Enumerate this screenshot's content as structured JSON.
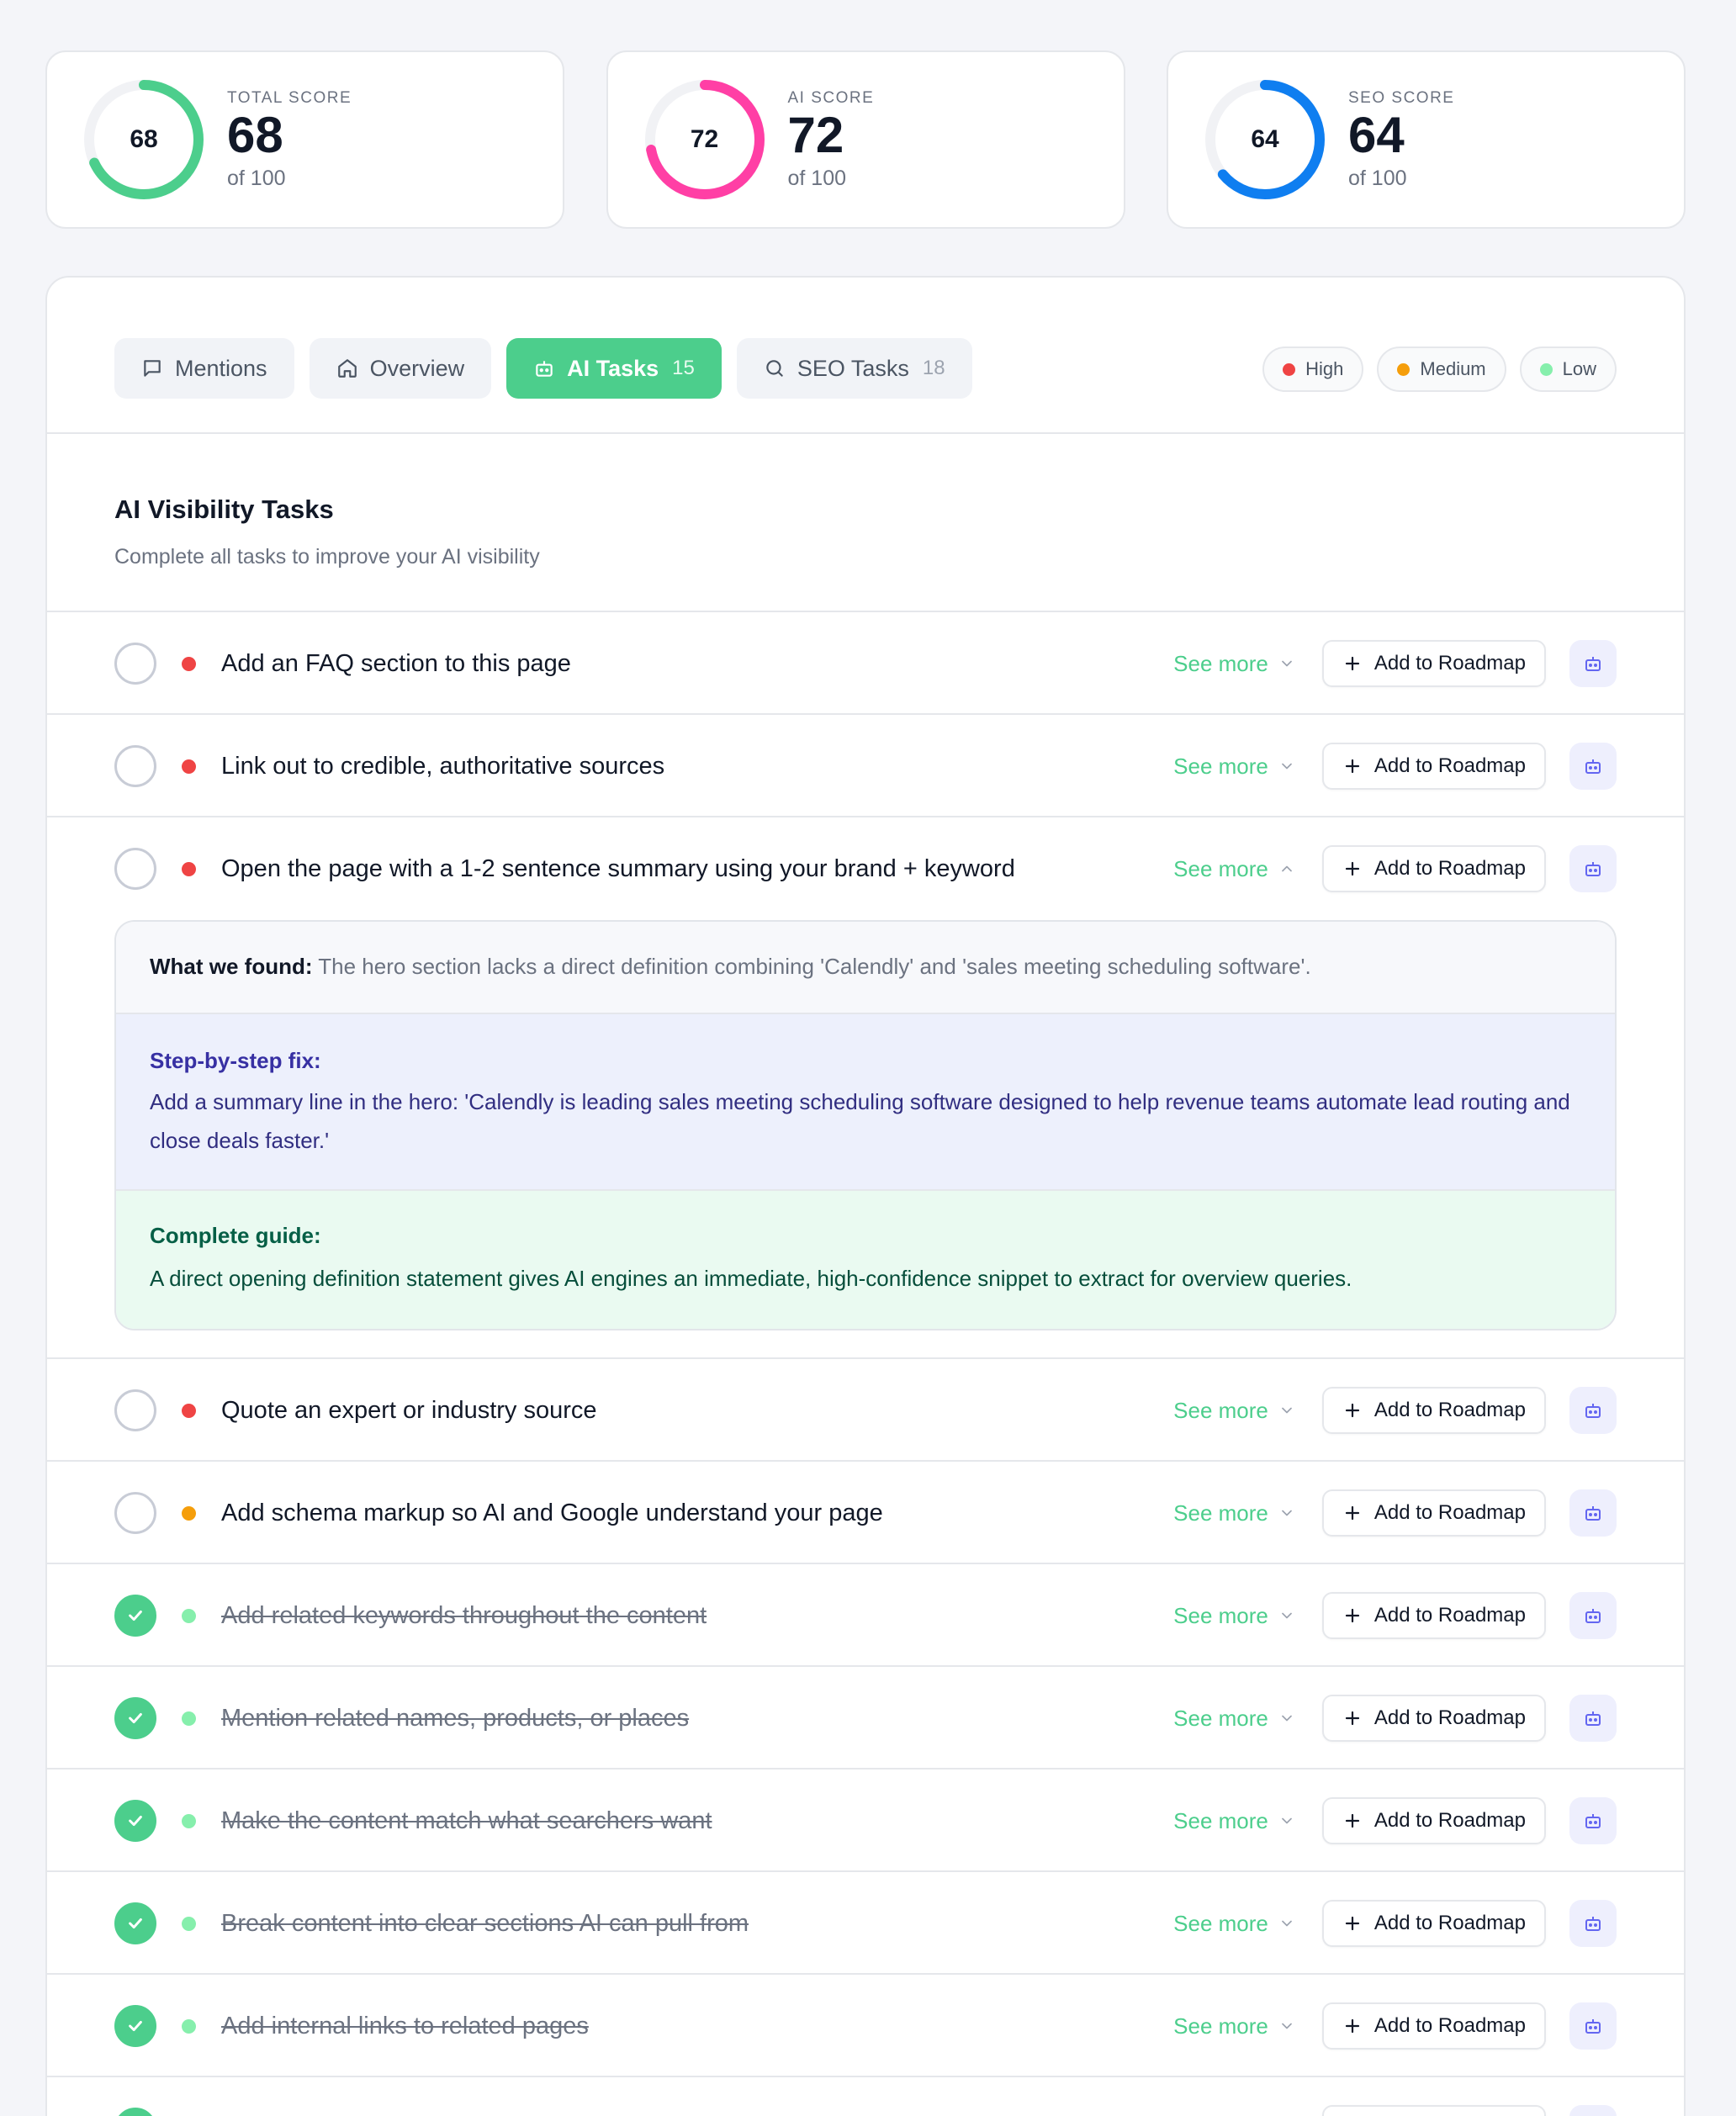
{
  "scores": [
    {
      "label": "TOTAL SCORE",
      "value": "68",
      "of": "of 100",
      "percent": 68,
      "color": "#4cce8c"
    },
    {
      "label": "AI SCORE",
      "value": "72",
      "of": "of 100",
      "percent": 72,
      "color": "#ff3fa5"
    },
    {
      "label": "SEO SCORE",
      "value": "64",
      "of": "of 100",
      "percent": 64,
      "color": "#0f7ef0"
    }
  ],
  "tabs": [
    {
      "label": "Mentions",
      "icon": "message-square-icon",
      "count": ""
    },
    {
      "label": "Overview",
      "icon": "home-icon",
      "count": ""
    },
    {
      "label": "AI Tasks",
      "icon": "robot-icon",
      "count": "15",
      "active": true
    },
    {
      "label": "SEO Tasks",
      "icon": "search-icon",
      "count": "18"
    }
  ],
  "legend": [
    {
      "label": "High",
      "color": "#ef4444"
    },
    {
      "label": "Medium",
      "color": "#f59e0b"
    },
    {
      "label": "Low",
      "color": "#86efac"
    }
  ],
  "section": {
    "title": "AI Visibility Tasks",
    "subtitle": "Complete all tasks to improve your AI visibility"
  },
  "actions": {
    "see_more": "See more",
    "add_roadmap": "Add to Roadmap"
  },
  "tasks": [
    {
      "text": "Add an FAQ section to this page",
      "priority": "high",
      "done": false
    },
    {
      "text": "Link out to credible, authoritative sources",
      "priority": "high",
      "done": false
    },
    {
      "text": "Open the page with a 1-2 sentence summary using your brand + keyword",
      "priority": "high",
      "done": false,
      "expanded": true
    },
    {
      "text": "Quote an expert or industry source",
      "priority": "high",
      "done": false
    },
    {
      "text": "Add schema markup so AI and Google understand your page",
      "priority": "medium",
      "done": false
    },
    {
      "text": "Add related keywords throughout the content",
      "priority": "low",
      "done": true
    },
    {
      "text": "Mention related names, products, or places",
      "priority": "low",
      "done": true
    },
    {
      "text": "Make the content match what searchers want",
      "priority": "low",
      "done": true
    },
    {
      "text": "Break content into clear sections AI can pull from",
      "priority": "low",
      "done": true
    },
    {
      "text": "Add internal links to related pages",
      "priority": "low",
      "done": true
    },
    {
      "text": "",
      "priority": "low",
      "done": true
    }
  ],
  "details": {
    "found_label": "What we found:",
    "found_text": "The hero section lacks a direct definition combining 'Calendly' and 'sales meeting scheduling software'.",
    "fix_title": "Step-by-step fix:",
    "fix_text": "Add a summary line in the hero: 'Calendly is leading sales meeting scheduling software designed to help revenue teams automate lead routing and close deals faster.'",
    "guide_title": "Complete guide:",
    "guide_text": "A direct opening definition statement gives AI engines an immediate, high-confidence snippet to extract for overview queries."
  }
}
